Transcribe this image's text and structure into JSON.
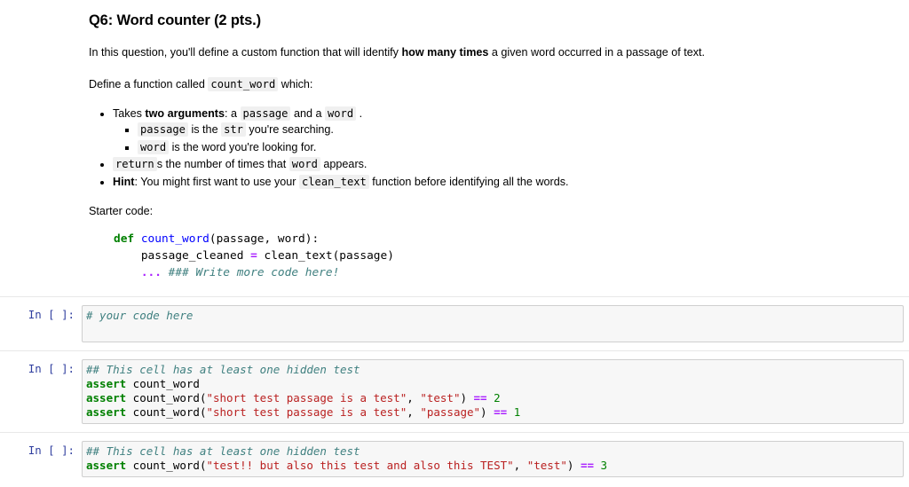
{
  "markdown": {
    "title": "Q6: Word counter (2 pts.)",
    "intro": {
      "before": "In this question, you'll define a custom function that will identify ",
      "bold": "how many times",
      "after": " a given word occurred in a passage of text."
    },
    "define_line": {
      "before": "Define a function called ",
      "code": "count_word",
      "after": " which:"
    },
    "bullets": {
      "takes": {
        "pre": "Takes ",
        "bold": "two arguments",
        "mid": ": a ",
        "code1": "passage",
        "mid2": " and a ",
        "code2": "word",
        "post": " ."
      },
      "sub_passage": {
        "code": "passage",
        "mid": " is the ",
        "code2": "str",
        "post": " you're searching."
      },
      "sub_word": {
        "code": "word",
        "post": " is the word you're looking for."
      },
      "returns": {
        "code": "return",
        "mid": "s the number of times that ",
        "code2": "word",
        "post": " appears."
      },
      "hint": {
        "bold": "Hint",
        "mid": ": You might first want to use your ",
        "code": "clean_text",
        "post": " function before identifying all the words."
      }
    },
    "starter_label": "Starter code:",
    "starter_code": {
      "line1_kw": "def",
      "line1_fname": " count_word",
      "line1_rest": "(passage, word):",
      "line2_indent": "    ",
      "line2_lhs": "passage_cleaned ",
      "line2_op": "=",
      "line2_rhs": " clean_text(passage)",
      "line3_indent": "    ",
      "line3_ellipsis": "...",
      "line3_comment": " ### Write more code here!"
    }
  },
  "cells": [
    {
      "prompt": "In [ ]:",
      "lines": [
        [
          {
            "t": "# your code here",
            "c": "t-comment"
          }
        ]
      ]
    },
    {
      "prompt": "In [ ]:",
      "lines": [
        [
          {
            "t": "## This cell has at least one hidden test",
            "c": "t-comment"
          }
        ],
        [
          {
            "t": "assert",
            "c": "t-kw"
          },
          {
            "t": " count_word",
            "c": "t-name"
          }
        ],
        [
          {
            "t": "assert",
            "c": "t-kw"
          },
          {
            "t": " count_word(",
            "c": "t-name"
          },
          {
            "t": "\"short test passage is a test\"",
            "c": "t-str"
          },
          {
            "t": ", ",
            "c": "t-name"
          },
          {
            "t": "\"test\"",
            "c": "t-str"
          },
          {
            "t": ") ",
            "c": "t-name"
          },
          {
            "t": "==",
            "c": "t-op"
          },
          {
            "t": " ",
            "c": "t-name"
          },
          {
            "t": "2",
            "c": "t-num"
          }
        ],
        [
          {
            "t": "assert",
            "c": "t-kw"
          },
          {
            "t": " count_word(",
            "c": "t-name"
          },
          {
            "t": "\"short test passage is a test\"",
            "c": "t-str"
          },
          {
            "t": ", ",
            "c": "t-name"
          },
          {
            "t": "\"passage\"",
            "c": "t-str"
          },
          {
            "t": ") ",
            "c": "t-name"
          },
          {
            "t": "==",
            "c": "t-op"
          },
          {
            "t": " ",
            "c": "t-name"
          },
          {
            "t": "1",
            "c": "t-num"
          }
        ]
      ]
    },
    {
      "prompt": "In [ ]:",
      "lines": [
        [
          {
            "t": "## This cell has at least one hidden test",
            "c": "t-comment"
          }
        ],
        [
          {
            "t": "assert",
            "c": "t-kw"
          },
          {
            "t": " count_word(",
            "c": "t-name"
          },
          {
            "t": "\"test!! but also this test and also this TEST\"",
            "c": "t-str"
          },
          {
            "t": ", ",
            "c": "t-name"
          },
          {
            "t": "\"test\"",
            "c": "t-str"
          },
          {
            "t": ") ",
            "c": "t-name"
          },
          {
            "t": "==",
            "c": "t-op"
          },
          {
            "t": " ",
            "c": "t-name"
          },
          {
            "t": "3",
            "c": "t-num"
          }
        ]
      ]
    }
  ]
}
